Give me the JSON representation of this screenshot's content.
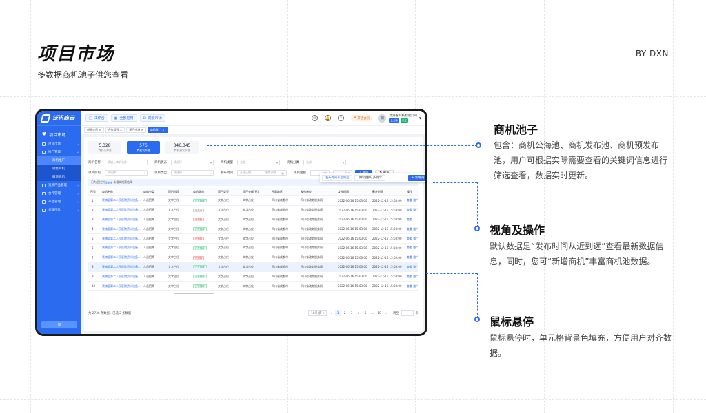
{
  "page": {
    "title": "项目市场",
    "subtitle": "多数据商机池子供您查看",
    "by": "BY DXN"
  },
  "sidebar": {
    "brand": "泛讯商云",
    "module_title": "项目市场",
    "items": [
      {
        "label": "项目市场",
        "icon": "person-icon",
        "arrow": "›"
      },
      {
        "label": "推广管理",
        "icon": "monitor-icon",
        "arrow": "∨"
      },
      {
        "label": "商机推广",
        "sub": true,
        "active": true
      },
      {
        "label": "销售商机",
        "sub": true
      },
      {
        "label": "邀请商机",
        "sub": true
      },
      {
        "label": "资质产品管理",
        "icon": "doc-icon",
        "arrow": "›"
      },
      {
        "label": "合作管理",
        "icon": "person-icon",
        "arrow": "›"
      },
      {
        "label": "平台管理",
        "icon": "gear-icon",
        "arrow": "›"
      },
      {
        "label": "关联团队",
        "icon": "team-icon",
        "arrow": "›"
      }
    ],
    "collapse": "☰"
  },
  "topbar": {
    "buttons": [
      {
        "label": "工作台",
        "icon": "□"
      },
      {
        "label": "全部应用",
        "icon": "▦"
      },
      {
        "label": "商云市场",
        "icon": "⊡"
      }
    ],
    "vip": "开通会员",
    "user": {
      "company": "文渊省科技有限公司",
      "avatar": "渊",
      "tags": [
        "企业版",
        "认证"
      ]
    }
  },
  "tabs": [
    "新闻公示 ×",
    "合作管理 ×",
    "项目市场 ×",
    "商机推广 ×"
  ],
  "stats": [
    {
      "num": "5,328",
      "label": "商机公海池"
    },
    {
      "num": "576",
      "label": "商机发布池",
      "active": true
    },
    {
      "num": "346,345",
      "label": "商机预发布池"
    }
  ],
  "filters": {
    "row1": [
      {
        "label": "商机名称",
        "ph": "请输入商机名称"
      },
      {
        "label": "商机状态",
        "ph": "请选择"
      },
      {
        "label": "商机类型",
        "ph": "全部"
      },
      {
        "label": "商机分类",
        "ph": "全部"
      }
    ],
    "row2": [
      {
        "label": "项目阶段",
        "ph": "请选择"
      },
      {
        "label": "项目类型",
        "ph": "请选择"
      }
    ],
    "time_label": "发布时间",
    "time_start": "开始日期",
    "time_sep": "—",
    "time_end": "结束日期",
    "amount_label": "项目金额",
    "amount_min": "万元",
    "amount_max": "万元",
    "search": "查询",
    "reset": "重置"
  },
  "sort": {
    "option1": "发布时间从近到远",
    "option2": "项目金额从多到少",
    "add": "+ 新增商机"
  },
  "selected": {
    "prefix": "已为您找到",
    "count": "3806",
    "suffix": "条相关搜索结果"
  },
  "table": {
    "headers": [
      "序号",
      "商机名称",
      "商机分类",
      "项目阶段",
      "商机状态",
      "项目类型",
      "项目金额(元)",
      "所属地区",
      "发布单位",
      "发布时间",
      "截止时间",
      "操作"
    ],
    "rows": [
      {
        "no": "1",
        "name": "景楠县第二人民医院资料设备...",
        "cat": "人员招聘",
        "stage": "文字占位",
        "status": "正在推荐",
        "type": "文字占位",
        "amount": "文字占位",
        "region": "四川省成都市",
        "unit": "四川省政务服务网",
        "pub": "2022-06-16 15:03:00",
        "end": "2022-12-16 15:03:00",
        "ops": "查看  推广"
      },
      {
        "no": "2",
        "name": "景楠县第二人民医院资料设备...",
        "cat": "人员招聘",
        "stage": "文字占位",
        "status": "已关闭",
        "type": "文字占位",
        "amount": "文字占位",
        "region": "四川省成都市",
        "unit": "四川省政务服务网",
        "pub": "2022-06-16 15:03:00",
        "end": "2022-12-16 15:03:00",
        "ops": "查看  推广"
      },
      {
        "no": "3",
        "name": "景楠县第二人民医院资料设备...",
        "cat": "人员招聘",
        "stage": "文字占位",
        "status": "已预推",
        "type": "文字占位",
        "amount": "文字占位",
        "region": "四川省成都市",
        "unit": "四川省政务服务网",
        "pub": "2022-06-16 15:03:00",
        "end": "2022-12-16 15:03:00",
        "ops": "查看"
      },
      {
        "no": "4",
        "name": "景楠县第二人民医院资料设备...",
        "cat": "人员招聘",
        "stage": "文字占位",
        "status": "正在推荐",
        "type": "文字占位",
        "amount": "文字占位",
        "region": "四川省成都市",
        "unit": "四川省政务服务网",
        "pub": "2022-06-16 15:03:00",
        "end": "2022-12-16 15:03:00",
        "ops": "查看  推广"
      },
      {
        "no": "5",
        "name": "景楠县第二人民医院资料设备...",
        "cat": "人员招聘",
        "stage": "文字占位",
        "status": "已预推",
        "type": "文字占位",
        "amount": "文字占位",
        "region": "四川省成都市",
        "unit": "四川省政务服务网",
        "pub": "2022-06-16 15:03:00",
        "end": "2022-12-16 15:03:00",
        "ops": "查看  推广"
      },
      {
        "no": "6",
        "name": "景楠县第二人民医院资料设备...",
        "cat": "人员招聘",
        "stage": "文字占位",
        "status": "正在推荐",
        "type": "文字占位",
        "amount": "文字占位",
        "region": "四川省成都市",
        "unit": "四川省政务服务网",
        "pub": "2022-06-16 15:03:00",
        "end": "2022-12-16 15:03:00",
        "ops": "查看  推广"
      },
      {
        "no": "7",
        "name": "景楠县第二人民医院资料设备...",
        "cat": "人员招聘",
        "stage": "文字占位",
        "status": "已预推",
        "type": "文字占位",
        "amount": "文字占位",
        "region": "四川省成都市",
        "unit": "四川省政务服务网",
        "pub": "2022-06-16 15:03:00",
        "end": "2022-12-16 15:03:00",
        "ops": "查看  推广"
      },
      {
        "no": "8",
        "name": "景楠县第二人民医院资料设备...",
        "cat": "人员招聘",
        "stage": "文字占位",
        "status": "正在推荐",
        "type": "文字占位",
        "amount": "文字占位",
        "region": "四川省成都市",
        "unit": "四川省政务服务网",
        "pub": "2022-06-16 15:03:00",
        "end": "2022-12-16 15:03:00",
        "ops": "查看  推广",
        "hover": true
      },
      {
        "no": "9",
        "name": "景楠县第二人民医院资料设备...",
        "cat": "人员招聘",
        "stage": "文字占位",
        "status": "正在推荐",
        "type": "文字占位",
        "amount": "文字占位",
        "region": "四川省成都市",
        "unit": "四川省政务服务网",
        "pub": "2022-06-16 15:03:00",
        "end": "2022-12-16 15:03:00",
        "ops": "查看  推广"
      },
      {
        "no": "10",
        "name": "景楠县第二人民医院资料设备...",
        "cat": "人员招聘",
        "stage": "文字占位",
        "status": "正在推荐",
        "type": "文字占位",
        "amount": "文字占位",
        "region": "四川省成都市",
        "unit": "四川省政务服务网",
        "pub": "2022-06-16 15:03:00",
        "end": "2022-12-16 15:03:00",
        "ops": "查看  推广"
      }
    ]
  },
  "pager": {
    "total": "共 2736 条数据，已选 2 条数据",
    "size": "10条/页",
    "prev": "‹",
    "pages": [
      "1",
      "2",
      "3",
      "4",
      "5",
      "...",
      "10"
    ],
    "next": "›",
    "goto": "跳至",
    "page_unit": "页"
  },
  "annotations": [
    {
      "title": "商机池子",
      "text": "包含：商机公海池、商机发布池、商机预发布池，用户可根据实际需要查看的关键词信息进行筛选查看，数据实时更新。"
    },
    {
      "title": "视角及操作",
      "text": "默认数据是“发布时间从近到远”查看最新数据信息，同时，您可“新增商机”丰富商机池数据。"
    },
    {
      "title": "鼠标悬停",
      "text": "鼠标悬停时，单元格背景色填充，方便用户对齐数据。"
    }
  ]
}
